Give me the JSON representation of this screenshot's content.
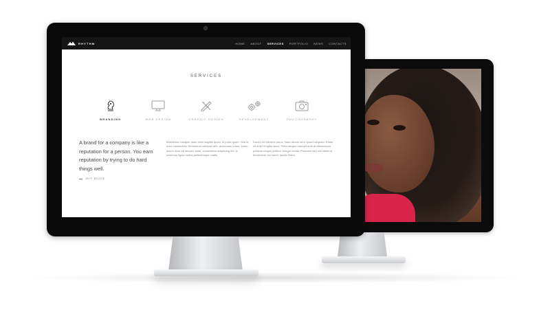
{
  "site": {
    "logo_text": "RHYTHM",
    "nav": [
      "HOME",
      "ABOUT",
      "SERVICES",
      "PORTFOLIO",
      "NEWS",
      "CONTACTS"
    ],
    "active_nav": "SERVICES"
  },
  "services_section": {
    "title": "SERVICES",
    "items": [
      {
        "label": "BRANDING",
        "icon": "knight-icon",
        "active": true
      },
      {
        "label": "WEB DESIGN",
        "icon": "monitor-icon",
        "active": false
      },
      {
        "label": "GRAPHIC DESIGN",
        "icon": "pencil-ruler-icon",
        "active": false
      },
      {
        "label": "DEVELOPMENT",
        "icon": "gears-icon",
        "active": false
      },
      {
        "label": "PHOTOGRAPHY",
        "icon": "camera-icon",
        "active": false
      }
    ]
  },
  "quote": {
    "text": "A brand for a company is like a reputation for a person. You earn reputation by trying to do hard things well.",
    "author": "JEFF BEZOS"
  },
  "paragraphs": [
    "Maecenas volutpat, diam enim sagittis quam, id porta quam. Sed id dolor consectetur fermentum volutpat nibh, accumsan purus, lorem ipsum dolor sit semper amet, consectetur adipiscing elit. In maximus ligula metus pellentesque mattis.",
    "Donec vel ultricies purus. Nam dictum sem, ipsum aliquam. Etiam sit amet fringilla lacus. Pellentesque suscipit ante at ullamcorper pulvinar neque porttitor. Integer lectus. Praesent sed nisl eleifend, fermentum orci amet, iaculis libero."
  ],
  "colors": {
    "nav_bg": "#151515",
    "bezel": "#0a0a0a",
    "shirt": "#d8244a"
  }
}
